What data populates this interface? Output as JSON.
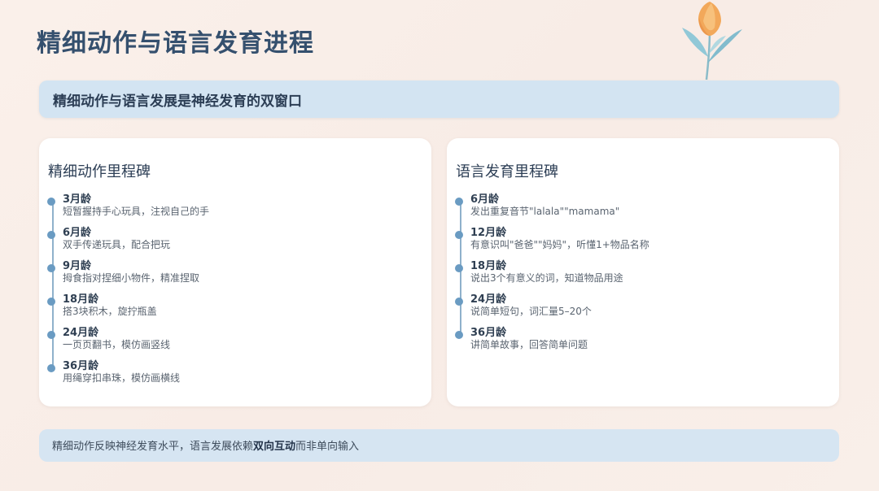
{
  "title": "精细动作与语言发育进程",
  "banner": "精细动作与语言发展是神经发育的双窗口",
  "motor": {
    "heading": "精细动作里程碑",
    "items": [
      {
        "age": "3月龄",
        "desc": "短暂握持手心玩具，注视自己的手"
      },
      {
        "age": "6月龄",
        "desc": "双手传递玩具，配合把玩"
      },
      {
        "age": "9月龄",
        "desc": "拇食指对捏细小物件，精准捏取"
      },
      {
        "age": "18月龄",
        "desc": "搭3块积木，旋拧瓶盖"
      },
      {
        "age": "24月龄",
        "desc": "一页页翻书，模仿画竖线"
      },
      {
        "age": "36月龄",
        "desc": "用绳穿扣串珠，模仿画横线"
      }
    ]
  },
  "language": {
    "heading": "语言发育里程碑",
    "items": [
      {
        "age": "6月龄",
        "desc": "发出重复音节\"lalala\"\"mamama\""
      },
      {
        "age": "12月龄",
        "desc": "有意识叫\"爸爸\"\"妈妈\"，听懂1+物品名称"
      },
      {
        "age": "18月龄",
        "desc": "说出3个有意义的词，知道物品用途"
      },
      {
        "age": "24月龄",
        "desc": "说简单短句，词汇量5–20个"
      },
      {
        "age": "36月龄",
        "desc": "讲简单故事，回答简单问题"
      }
    ]
  },
  "footer": {
    "before": "精细动作反映神经发育水平，语言发展依赖",
    "bold": "双向互动",
    "after": "而非单向输入"
  },
  "colors": {
    "accent": "#6a9bc2",
    "title": "#35506e",
    "banner_bg": "#d3e4f2"
  },
  "icons": {
    "decoration": "tulip-flower-illustration"
  }
}
